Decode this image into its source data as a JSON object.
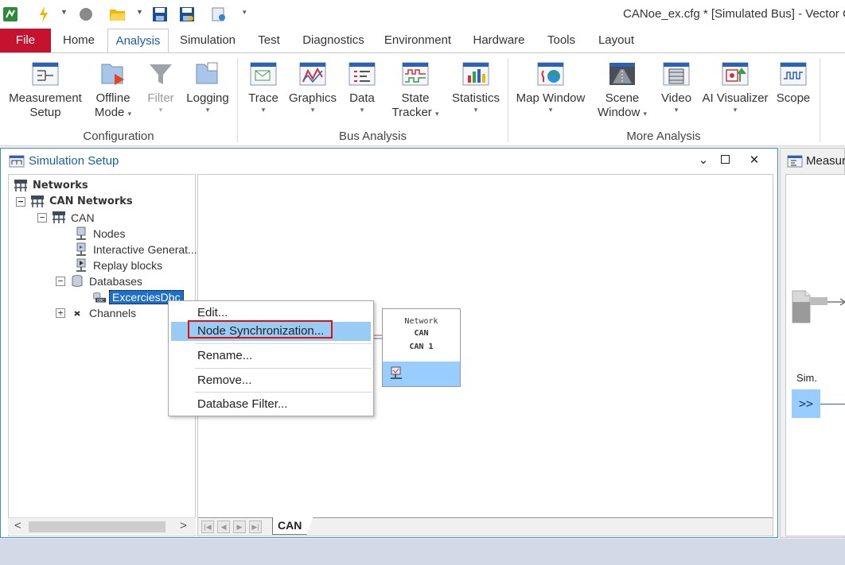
{
  "app": {
    "title": "CANoe_ex.cfg * [Simulated Bus] - Vector C"
  },
  "tabs": [
    "File",
    "Home",
    "Analysis",
    "Simulation",
    "Test",
    "Diagnostics",
    "Environment",
    "Hardware",
    "Tools",
    "Layout"
  ],
  "active_tab": "Analysis",
  "ribbon": {
    "groups": {
      "configuration": "Configuration",
      "bus_analysis": "Bus Analysis",
      "more_analysis": "More Analysis"
    },
    "buttons": {
      "measurement_setup": [
        "Measurement",
        "Setup"
      ],
      "offline_mode": [
        "Offline",
        "Mode"
      ],
      "filter": [
        "Filter"
      ],
      "logging": [
        "Logging"
      ],
      "trace": [
        "Trace"
      ],
      "graphics": [
        "Graphics"
      ],
      "data": [
        "Data"
      ],
      "state_tracker": [
        "State",
        "Tracker"
      ],
      "statistics": [
        "Statistics"
      ],
      "map_window": [
        "Map Window"
      ],
      "scene_window": [
        "Scene",
        "Window"
      ],
      "video": [
        "Video"
      ],
      "ai_visualizer": [
        "AI Visualizer"
      ],
      "scope": [
        "Scope"
      ]
    }
  },
  "sim_window": {
    "title": "Simulation Setup",
    "tree": {
      "networks": "Networks",
      "can_networks": "CAN Networks",
      "can": "CAN",
      "nodes": "Nodes",
      "interactive_generators": "Interactive Generat...",
      "replay_blocks": "Replay blocks",
      "databases": "Databases",
      "database_item": "ExcerciesDbc",
      "channels": "Channels"
    },
    "network_box": {
      "line1": "Network",
      "line2": "CAN",
      "line3": "CAN 1"
    },
    "sheet_tab": "CAN"
  },
  "context_menu": {
    "items": [
      "Edit...",
      "Node Synchronization...",
      "Rename...",
      "Remove...",
      "Database Filter..."
    ],
    "hovered": "Node Synchronization..."
  },
  "meas_window": {
    "title": "Measur",
    "sim_label": "Sim.",
    "sim_button": ">>"
  },
  "colors": {
    "accent": "#1a5ea8",
    "file_tab": "#c4122f",
    "selection": "#1c6fc9",
    "menu_hover": "#99ccf5",
    "highlight_box": "#e01010"
  }
}
